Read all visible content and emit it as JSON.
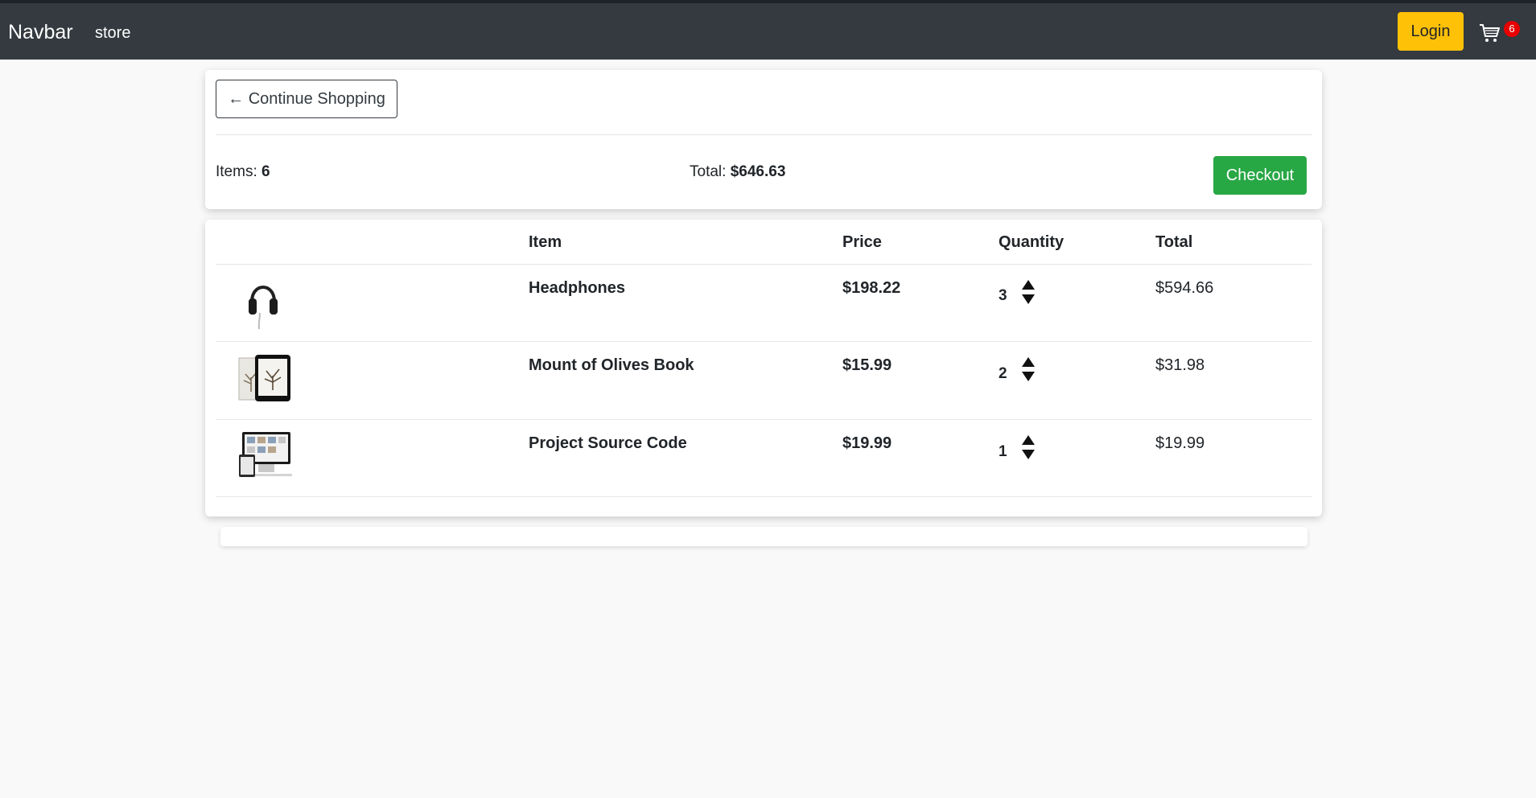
{
  "navbar": {
    "brand": "Navbar",
    "links": [
      "store"
    ],
    "login_label": "Login",
    "cart_count": "6",
    "cart_icon": "shopping-cart-icon",
    "bg_color": "#343a40",
    "login_color": "#ffc107",
    "badge_color": "#e80000"
  },
  "summary": {
    "continue_label": "← Continue Shopping",
    "items_label": "Items:",
    "items_value": "6",
    "total_label": "Total:",
    "total_value": "$646.63",
    "checkout_label": "Checkout",
    "checkout_color": "#28a745"
  },
  "table": {
    "headers": [
      "",
      "Item",
      "Price",
      "Quantity",
      "Total"
    ],
    "rows": [
      {
        "thumb_icon": "headphones-icon",
        "item": "Headphones",
        "price": "$198.22",
        "quantity": "3",
        "total": "$594.66"
      },
      {
        "thumb_icon": "book-tablet-icon",
        "item": "Mount of Olives Book",
        "price": "$15.99",
        "quantity": "2",
        "total": "$31.98"
      },
      {
        "thumb_icon": "source-code-screens-icon",
        "item": "Project Source Code",
        "price": "$19.99",
        "quantity": "1",
        "total": "$19.99"
      }
    ]
  }
}
